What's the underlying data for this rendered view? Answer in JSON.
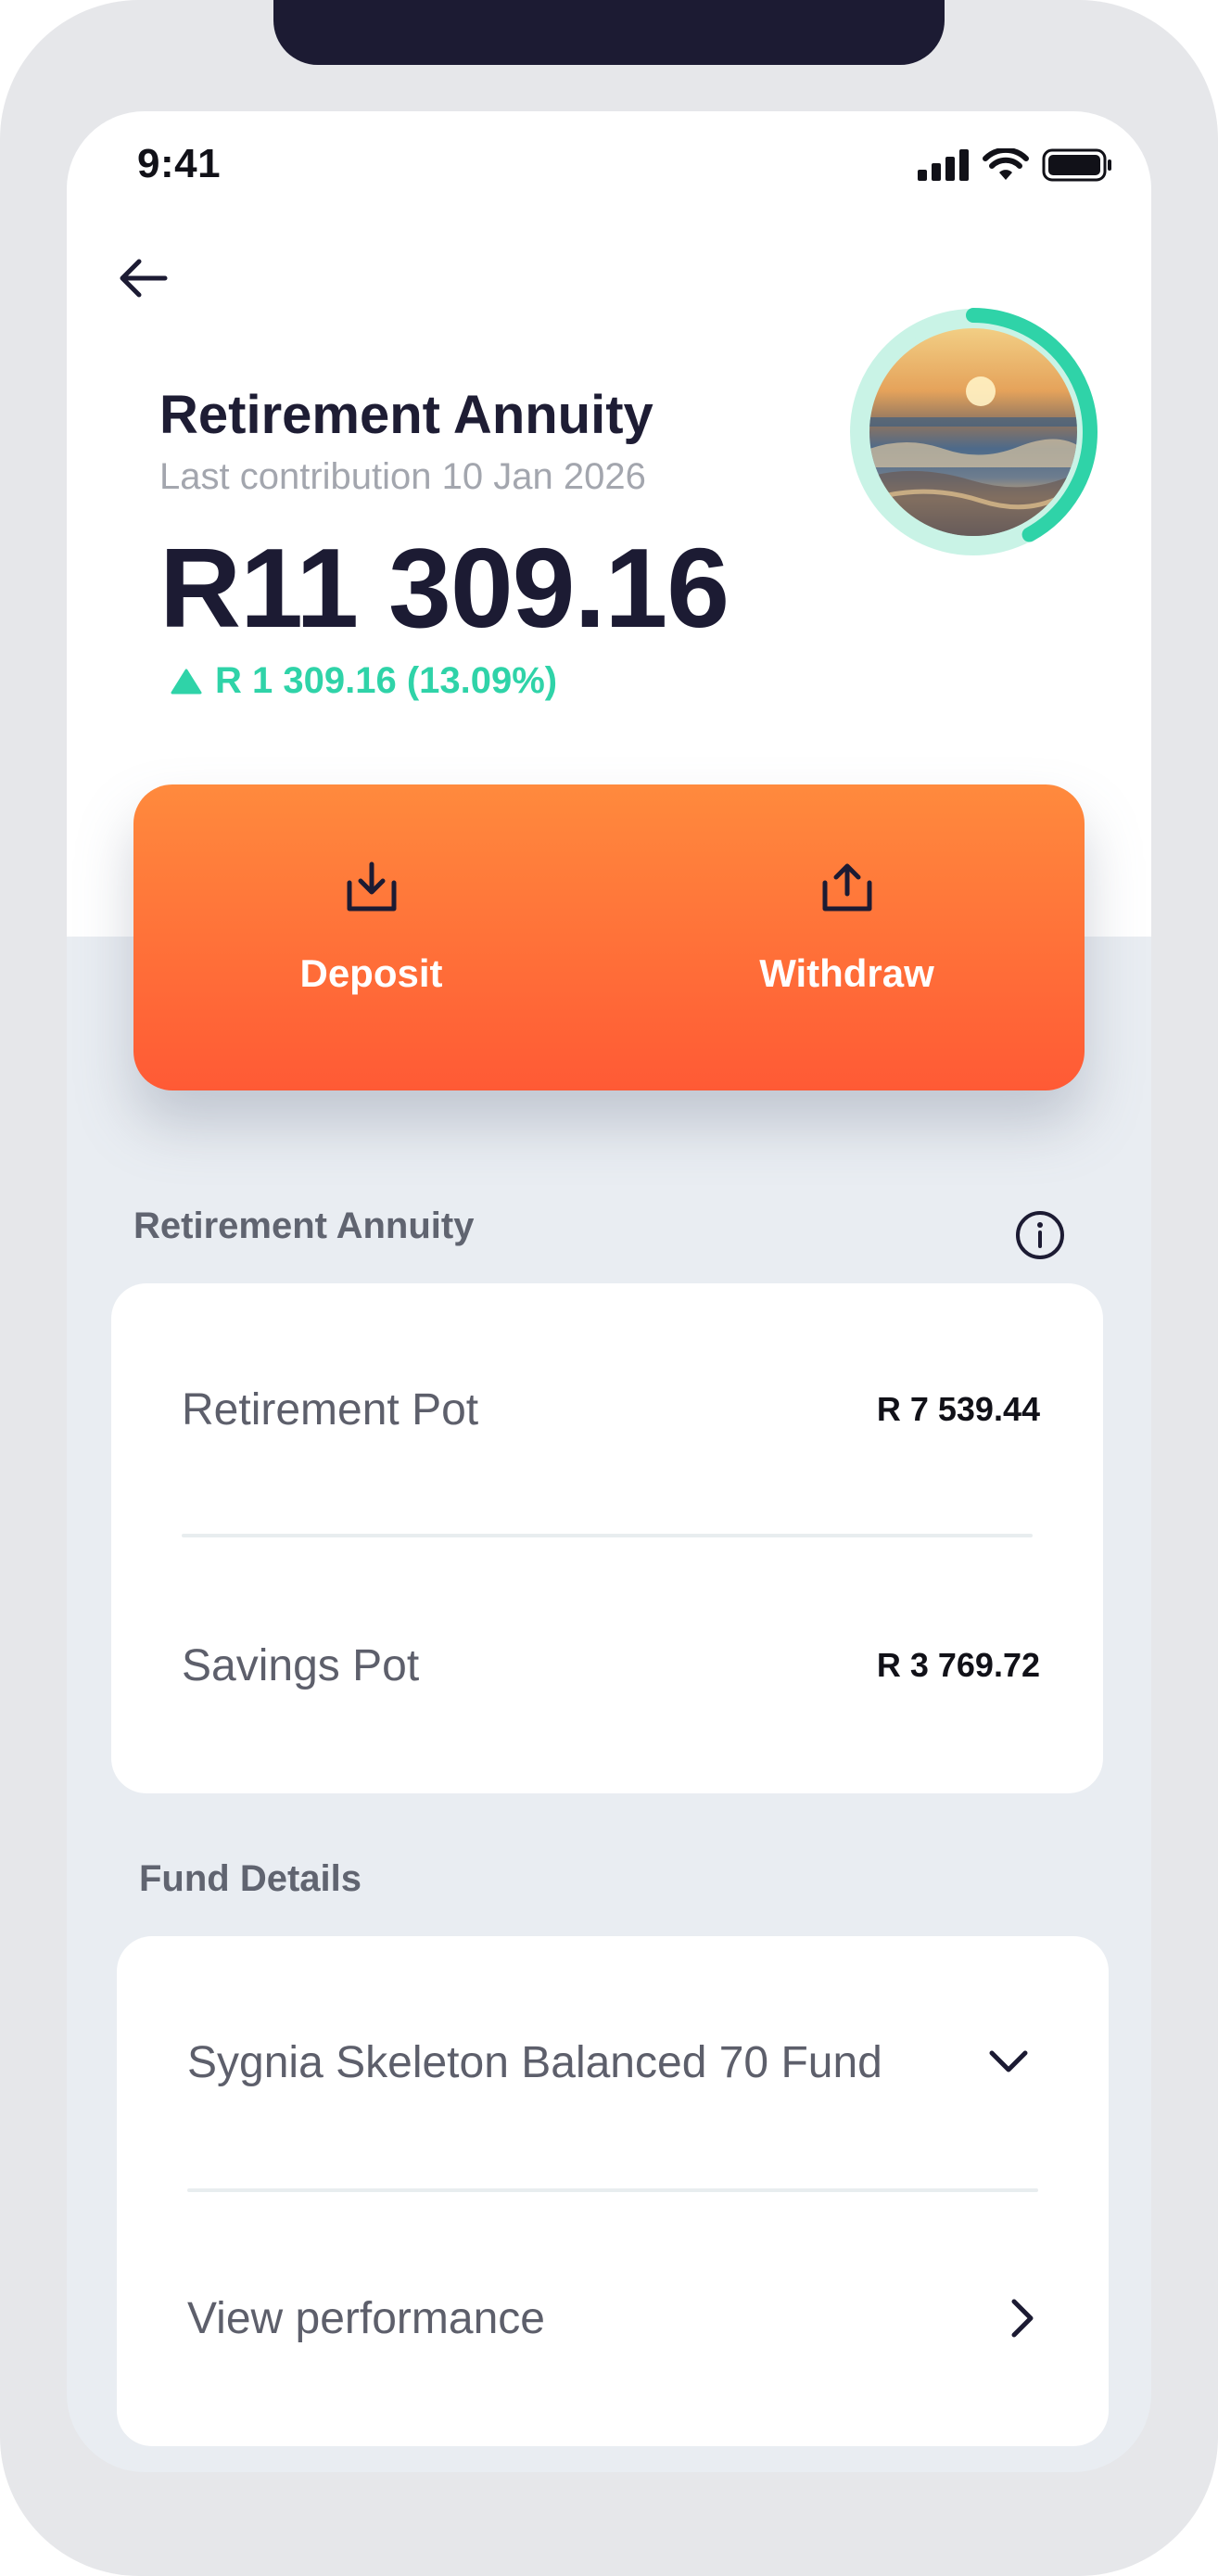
{
  "status_bar": {
    "time": "9:41"
  },
  "header": {
    "title": "Retirement Annuity",
    "subtitle": "Last contribution 10 Jan 2026",
    "balance": "R11 309.16",
    "change": "R 1 309.16 (13.09%)",
    "progress_fraction": 0.42
  },
  "actions": {
    "deposit_label": "Deposit",
    "withdraw_label": "Withdraw"
  },
  "annuity_section": {
    "label": "Retirement Annuity",
    "rows": [
      {
        "label": "Retirement Pot",
        "value": "R 7 539.44"
      },
      {
        "label": "Savings Pot",
        "value": "R 3 769.72"
      }
    ]
  },
  "fund_section": {
    "label": "Fund Details",
    "fund_name": "Sygnia Skeleton Balanced 70 Fund",
    "performance_label": "View performance"
  },
  "colors": {
    "accent_green": "#2fd3a8",
    "action_gradient_top": "#ff8a3d",
    "action_gradient_bottom": "#ff5a35",
    "dark_text": "#1c1b33"
  },
  "icons": {
    "back": "arrow-left-icon",
    "deposit": "download-tray-icon",
    "withdraw": "upload-tray-icon",
    "info": "info-circle-icon",
    "expand": "chevron-down-icon",
    "navigate": "chevron-right-icon"
  }
}
